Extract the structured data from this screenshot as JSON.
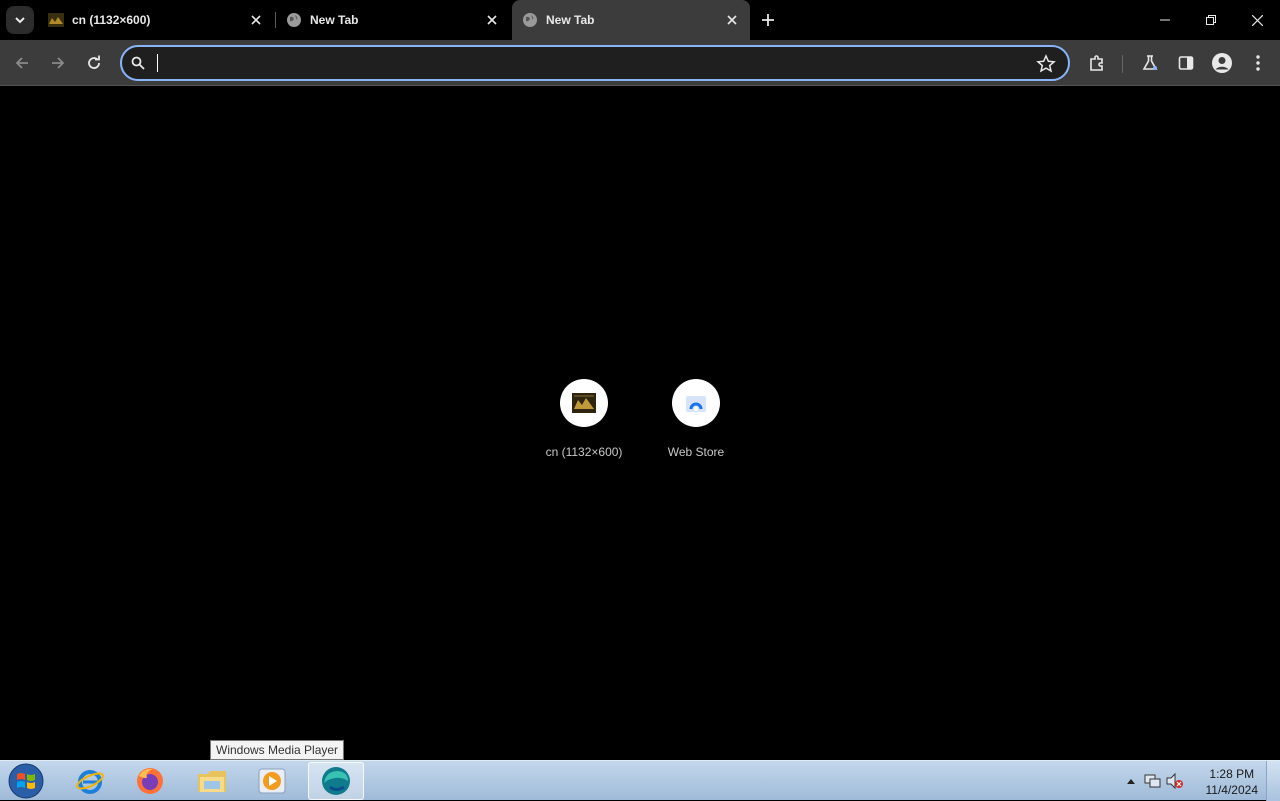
{
  "tabs": [
    {
      "title": "cn (1132×600)",
      "active": false,
      "favicon": "image-thumbnail-icon"
    },
    {
      "title": "New Tab",
      "active": false,
      "favicon": "globe-icon"
    },
    {
      "title": "New Tab",
      "active": true,
      "favicon": "globe-icon"
    }
  ],
  "omnibox": {
    "value": "",
    "placeholder": ""
  },
  "shortcuts": [
    {
      "label": "cn (1132×600)",
      "icon": "image-thumbnail-icon"
    },
    {
      "label": "Web Store",
      "icon": "web-store-icon"
    }
  ],
  "taskbar": {
    "apps": [
      "internet-explorer-icon",
      "firefox-icon",
      "file-explorer-icon",
      "windows-media-player-icon",
      "edge-icon"
    ],
    "tooltip": "Windows Media Player",
    "clock": {
      "time": "1:28 PM",
      "date": "11/4/2024"
    }
  },
  "colors": {
    "accent": "#8ab4f8",
    "toolbar": "#3c3c3c",
    "background": "#000000"
  }
}
